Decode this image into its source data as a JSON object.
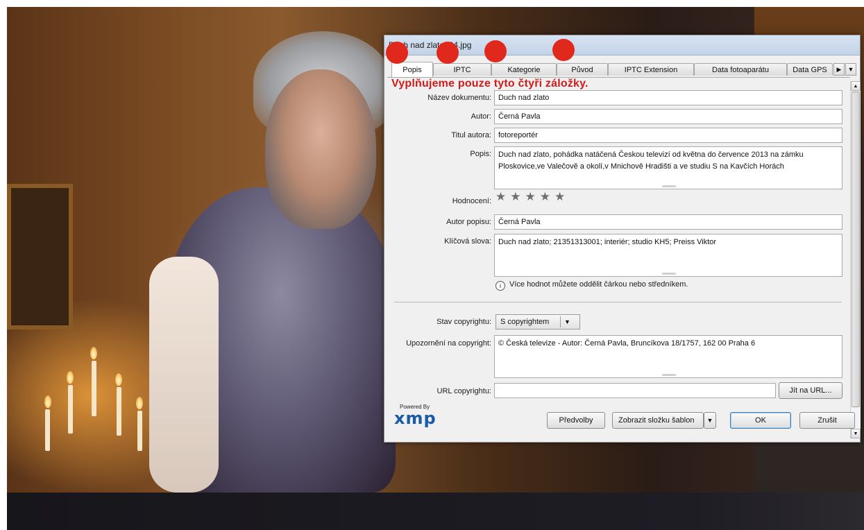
{
  "window": {
    "title": "Duch nad zlato004.jpg"
  },
  "tabs": [
    {
      "label": "Popis",
      "active": true
    },
    {
      "label": "IPTC"
    },
    {
      "label": "Kategorie"
    },
    {
      "label": "Původ"
    },
    {
      "label": "IPTC Extension"
    },
    {
      "label": "Data fotoaparátu"
    },
    {
      "label": "Data GPS"
    }
  ],
  "annotation": {
    "text": "Vyplňujeme pouze  tyto čtyři záložky.",
    "color": "#d11b1b"
  },
  "form": {
    "document_title": {
      "label": "Název dokumentu:",
      "value": "Duch nad zlato"
    },
    "author": {
      "label": "Autor:",
      "value": "Černá Pavla"
    },
    "author_title": {
      "label": "Titul autora:",
      "value": "fotoreportér"
    },
    "description": {
      "label": "Popis:",
      "value": "Duch nad zlato, pohádka natáčená Českou televizí od května do července 2013 na zámku Ploskovice,ve Valečově a okolí,v Mnichově Hradišti a ve studiu S na Kavčích Horách"
    },
    "rating": {
      "label": "Hodnocení:",
      "stars": 5,
      "filled": 0
    },
    "description_writer": {
      "label": "Autor popisu:",
      "value": "Černá Pavla"
    },
    "keywords": {
      "label": "Klíčová slova:",
      "value": "Duch nad zlato; 21351313001; interiér; studio KH5; Preiss Viktor"
    },
    "hint": "Více hodnot můžete oddělit čárkou nebo středníkem.",
    "copyright_status": {
      "label": "Stav copyrightu:",
      "value": "S copyrightem"
    },
    "copyright_notice": {
      "label": "Upozornění na copyright:",
      "value": "© Česká televize - Autor: Černá Pavla, Bruncíkova 18/1757, 162 00 Praha 6"
    },
    "copyright_url": {
      "label": "URL copyrightu:",
      "value": "",
      "go_button": "Jít na URL..."
    }
  },
  "footer": {
    "powered_by": "Powered By",
    "logo_text": "xmp",
    "preferences_button": "Předvolby",
    "show_templates_button": "Zobrazit složku šablon",
    "ok_button": "OK",
    "cancel_button": "Zrušit"
  },
  "icons": {
    "tabs_scroll_right": "triangle-right-icon",
    "tabs_menu": "chevron-down-icon",
    "info": "info-icon",
    "dropdown": "chevron-down-icon",
    "scroll_up": "scroll-up-icon",
    "scroll_down": "scroll-down-icon"
  },
  "colors": {
    "highlight_circle": "#e0281c",
    "xmp_logo": "#1b5aa6"
  }
}
